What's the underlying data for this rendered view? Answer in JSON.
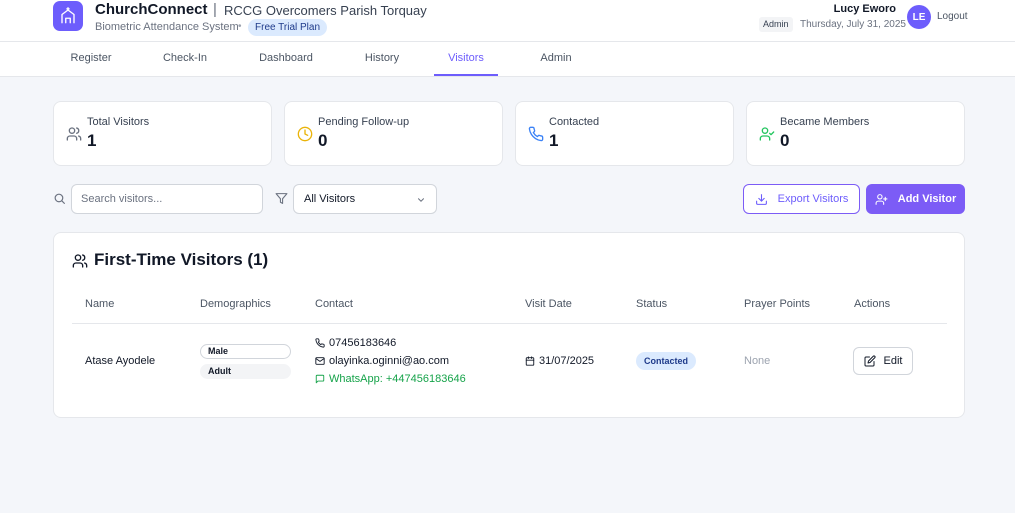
{
  "header": {
    "app_name": "ChurchConnect",
    "separator": "|",
    "org_name": "RCCG Overcomers Parish Torquay",
    "subtitle": "Biometric Attendance System",
    "dot": "•",
    "plan_badge": "Free Trial Plan",
    "user_name": "Lucy Eworo",
    "role_badge": "Admin",
    "date": "Thursday, July 31, 2025",
    "avatar_initials": "LE",
    "logout_label": "Logout"
  },
  "tabs": [
    {
      "label": "Register"
    },
    {
      "label": "Check-In"
    },
    {
      "label": "Dashboard"
    },
    {
      "label": "History"
    },
    {
      "label": "Visitors",
      "active": true
    },
    {
      "label": "Admin"
    }
  ],
  "stats": [
    {
      "label": "Total Visitors",
      "value": "1",
      "icon": "users-icon",
      "color": "#6b7280"
    },
    {
      "label": "Pending Follow-up",
      "value": "0",
      "icon": "clock-icon",
      "color": "#eab308"
    },
    {
      "label": "Contacted",
      "value": "1",
      "icon": "phone-icon",
      "color": "#3b82f6"
    },
    {
      "label": "Became Members",
      "value": "0",
      "icon": "user-check-icon",
      "color": "#22c55e"
    }
  ],
  "toolbar": {
    "search_placeholder": "Search visitors...",
    "filter_value": "All Visitors",
    "export_label": "Export Visitors",
    "add_label": "Add Visitor"
  },
  "table": {
    "title": "First-Time Visitors (1)",
    "columns": [
      "Name",
      "Demographics",
      "Contact",
      "Visit Date",
      "Status",
      "Prayer Points",
      "Actions"
    ],
    "rows": [
      {
        "name": "Atase Ayodele",
        "gender": "Male",
        "age_group": "Adult",
        "phone": "07456183646",
        "email": "olayinka.oginni@ao.com",
        "whatsapp": "WhatsApp: +447456183646",
        "visit_date": "31/07/2025",
        "status": "Contacted",
        "prayer_points": "None",
        "action_label": "Edit"
      }
    ]
  },
  "colors": {
    "accent": "#6d5dfc",
    "whatsapp": "#16a34a",
    "status_bg": "#dbeafe"
  }
}
